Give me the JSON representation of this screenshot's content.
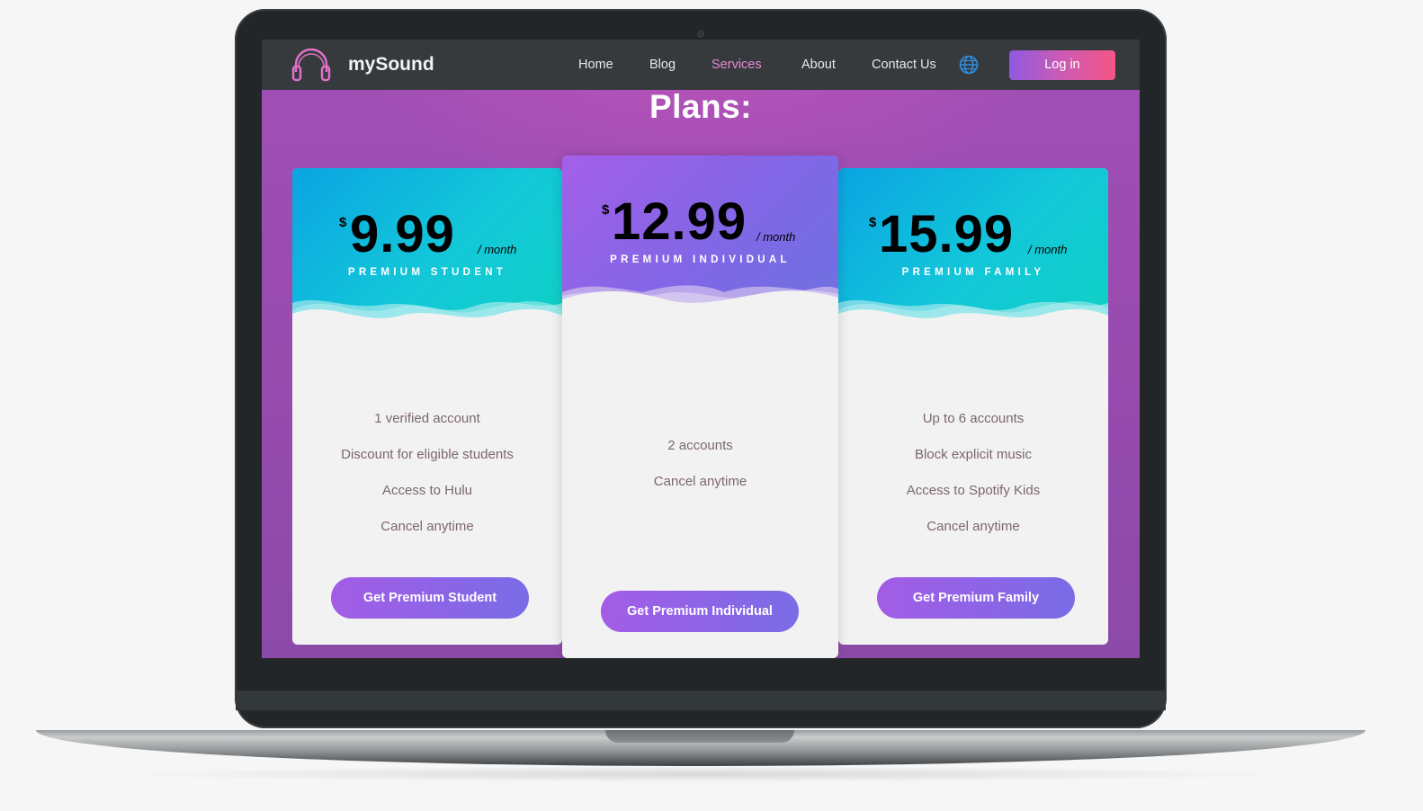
{
  "brand": {
    "name": "mySound",
    "accent": "#e88ad6"
  },
  "nav": {
    "items": [
      {
        "label": "Home",
        "active": false
      },
      {
        "label": "Blog",
        "active": false
      },
      {
        "label": "Services",
        "active": true
      },
      {
        "label": "About",
        "active": false
      },
      {
        "label": "Contact Us",
        "active": false
      }
    ],
    "language_icon": "globe-icon",
    "login_label": "Log in"
  },
  "page": {
    "title": "Plans:"
  },
  "plans": [
    {
      "currency": "$",
      "price": "9.99",
      "period": "/ month",
      "name": "PREMIUM STUDENT",
      "features": [
        "1 verified account",
        "Discount for eligible students",
        "Access to Hulu",
        "Cancel anytime"
      ],
      "cta": "Get Premium Student"
    },
    {
      "currency": "$",
      "price": "12.99",
      "period": "/ month",
      "name": "PREMIUM INDIVIDUAL",
      "features": [
        "2 accounts",
        "Cancel anytime"
      ],
      "cta": "Get Premium Individual"
    },
    {
      "currency": "$",
      "price": "15.99",
      "period": "/ month",
      "name": "PREMIUM FAMILY",
      "features": [
        "Up to 6 accounts",
        "Block explicit music",
        "Access to Spotify Kids",
        "Cancel anytime"
      ],
      "cta": "Get Premium Family"
    }
  ],
  "colors": {
    "side_header": "#0aa4e2",
    "center_header": "#8167e6",
    "button": "#8e62e6",
    "login_gradient_end": "#f55585"
  }
}
